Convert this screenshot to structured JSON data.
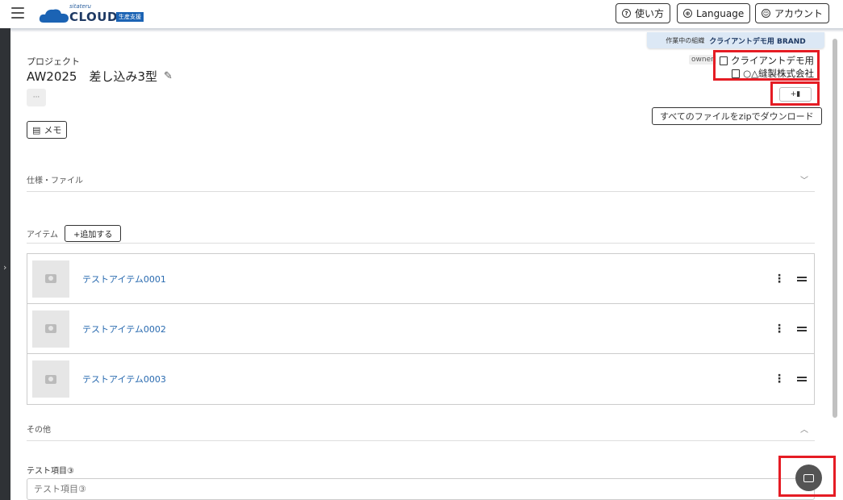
{
  "header": {
    "logo_small": "sitateru",
    "logo_text": "CLOUD",
    "logo_badge": "生産支援",
    "help_label": "使い方",
    "language_label": "Language",
    "account_label": "アカウント"
  },
  "org_banner": {
    "prefix": "作業中の組織",
    "name": "クライアントデモ用 BRAND"
  },
  "project": {
    "label": "プロジェクト",
    "title": "AW2025　差し込み3型",
    "more_label": "···",
    "memo_label": "メモ",
    "owner_tag": "owner",
    "orgs": [
      "クライアントデモ用",
      "○△縫製株式会社"
    ],
    "add_org_label": "+▮",
    "zip_label": "すべてのファイルをzipでダウンロード"
  },
  "sections": {
    "spec_files": "仕様・ファイル",
    "items": "アイテム",
    "add_item": "+追加する",
    "other": "その他"
  },
  "items": [
    {
      "name": "テストアイテム0001"
    },
    {
      "name": "テストアイテム0002"
    },
    {
      "name": "テストアイテム0003"
    }
  ],
  "test_field": {
    "label": "テスト項目③",
    "placeholder": "テスト項目③"
  },
  "icons": {
    "menu": "hamburger-icon",
    "help": "question-circle-icon",
    "language": "globe-icon",
    "account": "user-circle-icon",
    "chat": "chat-bubble-icon"
  },
  "colors": {
    "highlight": "#e51c24",
    "link": "#2a6bb0",
    "brand": "#1f3a64"
  }
}
